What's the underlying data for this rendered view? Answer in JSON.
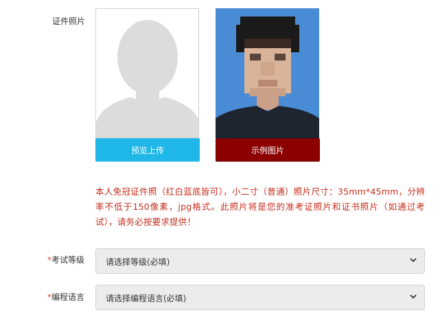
{
  "photo_field": {
    "label": "证件照片",
    "upload_button": "预览上传",
    "sample_button": "示例图片"
  },
  "note": "本人免冠证件照（红白蓝底皆可），小二寸（普通）照片尺寸：35mm*45mm，分辨率不低于150像素，jpg格式。此照片将是您的准考证照片和证书照片（如通过考试），请务必按要求提供！",
  "exam_level": {
    "required_mark": "*",
    "label": "考试等级",
    "selected": "请选择等级(必填)"
  },
  "language": {
    "required_mark": "*",
    "label": "编程语言",
    "selected": "请选择编程语言(必填)"
  },
  "colors": {
    "upload_button": "#1fb7e8",
    "sample_button": "#8c0000",
    "note_text": "#c62e1d",
    "sample_background": "#4a8bd6"
  }
}
